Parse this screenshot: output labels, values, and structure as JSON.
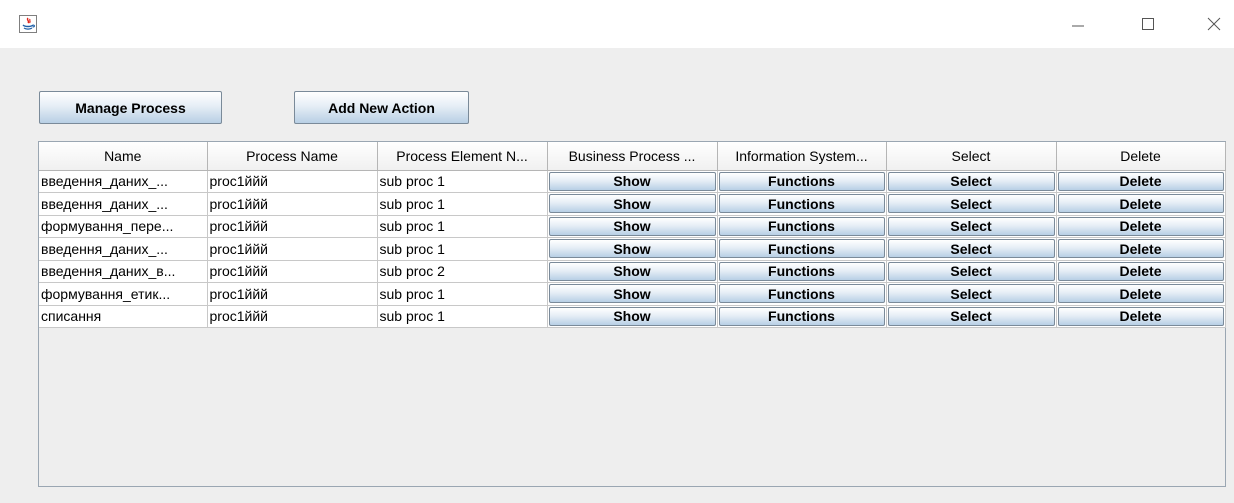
{
  "window": {
    "icons": {
      "app": "java-icon",
      "minimize": "minimize-icon",
      "maximize": "maximize-icon",
      "close": "close-icon"
    }
  },
  "toolbar": {
    "manage_label": "Manage Process",
    "add_label": "Add New Action"
  },
  "table": {
    "columns": [
      "Name",
      "Process Name",
      "Process Element N...",
      "Business Process ...",
      "Information System...",
      "Select",
      "Delete"
    ],
    "rows": [
      {
        "name": "введення_даних_...",
        "process": "proc1ййй",
        "element": "sub proc 1",
        "show": "Show",
        "functions": "Functions",
        "select": "Select",
        "delete": "Delete"
      },
      {
        "name": "введення_даних_...",
        "process": "proc1ййй",
        "element": "sub proc 1",
        "show": "Show",
        "functions": "Functions",
        "select": "Select",
        "delete": "Delete"
      },
      {
        "name": "формування_пере...",
        "process": "proc1ййй",
        "element": "sub proc 1",
        "show": "Show",
        "functions": "Functions",
        "select": "Select",
        "delete": "Delete"
      },
      {
        "name": "введення_даних_...",
        "process": "proc1ййй",
        "element": "sub proc 1",
        "show": "Show",
        "functions": "Functions",
        "select": "Select",
        "delete": "Delete"
      },
      {
        "name": "введення_даних_в...",
        "process": "proc1ййй",
        "element": "sub proc 2",
        "show": "Show",
        "functions": "Functions",
        "select": "Select",
        "delete": "Delete"
      },
      {
        "name": "формування_етик...",
        "process": "proc1ййй",
        "element": "sub proc 1",
        "show": "Show",
        "functions": "Functions",
        "select": "Select",
        "delete": "Delete"
      },
      {
        "name": "списання",
        "process": "proc1ййй",
        "element": "sub proc 1",
        "show": "Show",
        "functions": "Functions",
        "select": "Select",
        "delete": "Delete"
      }
    ]
  }
}
